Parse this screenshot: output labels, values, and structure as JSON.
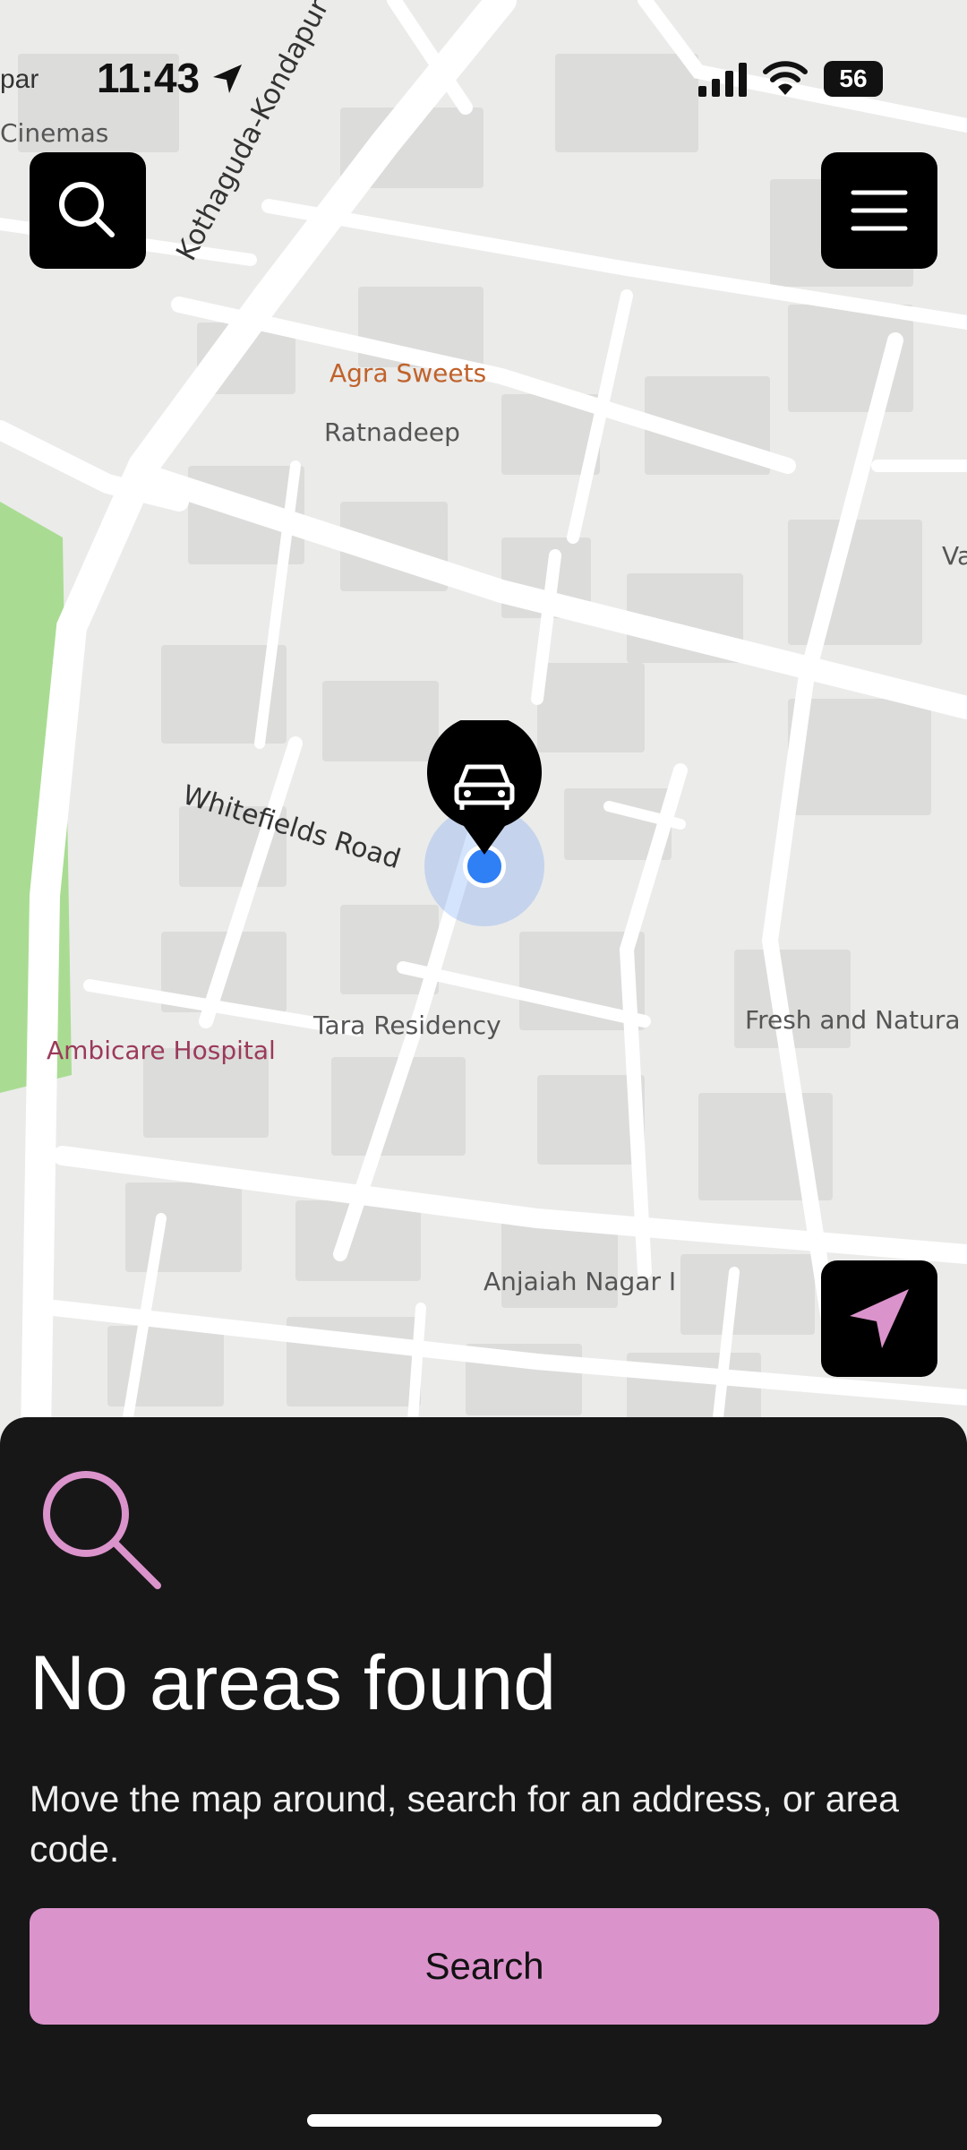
{
  "status_bar": {
    "time": "11:43",
    "battery": "56",
    "edge_text_left": "par"
  },
  "map": {
    "labels": {
      "cinemas": "Cinemas",
      "flyover": "Kothaguda-Kondapur Flyover",
      "agra_sweets": "Agra Sweets",
      "ratnadeep": "Ratnadeep",
      "va": "Va",
      "whitefields_road": "Whitefields Road",
      "tara_residency": "Tara Residency",
      "fresh_natural": "Fresh and Natura",
      "ambicare": "Ambicare Hospital",
      "anjaiah": "Anjaiah Nagar I"
    }
  },
  "buttons": {
    "search_icon": "search-icon",
    "menu_icon": "menu-icon",
    "locate_icon": "navigation-arrow-icon"
  },
  "sheet": {
    "title": "No areas found",
    "description": "Move the map around, search for an address, or area code.",
    "search_button": "Search",
    "accent": "#db93cc"
  }
}
